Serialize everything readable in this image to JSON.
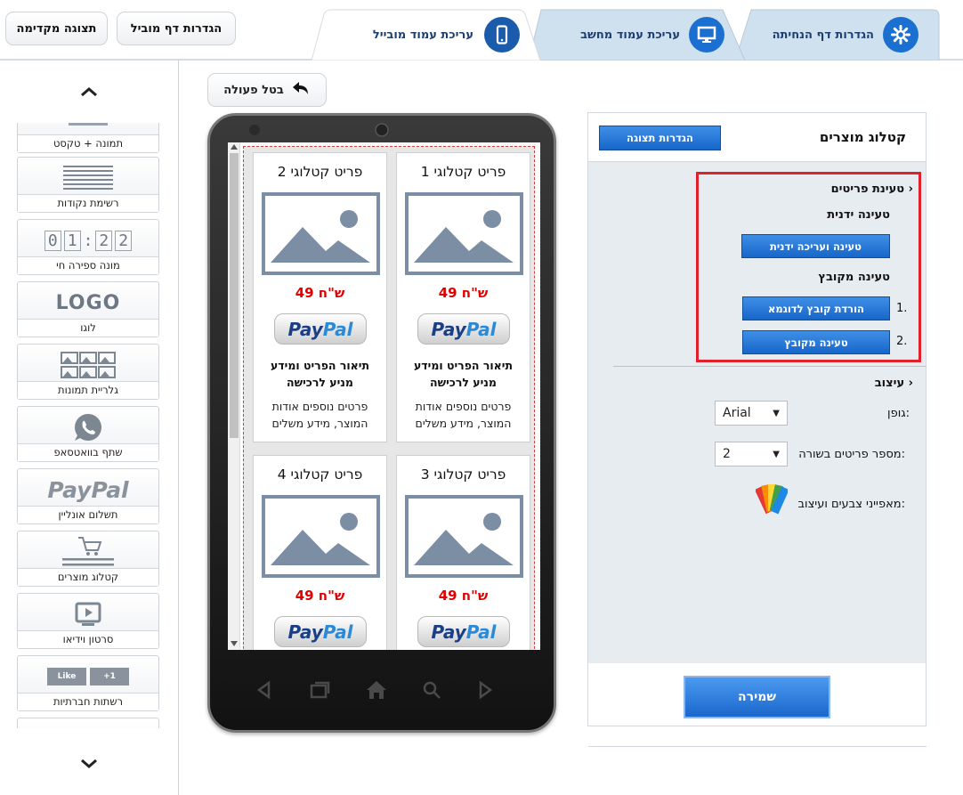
{
  "top": {
    "preview_label": "תצוגה מקדימה",
    "landing_settings_label": "הגדרות דף מוביל",
    "tabs": [
      {
        "label": "עריכת עמוד מובייל",
        "icon": "mobile-icon",
        "active": true
      },
      {
        "label": "עריכת עמוד מחשב",
        "icon": "desktop-icon",
        "active": false
      },
      {
        "label": "הגדרות דף הנחיתה",
        "icon": "gear-icon",
        "active": false
      }
    ]
  },
  "sidebar": {
    "items": [
      {
        "label": "תמונה + טקסט",
        "icon": "image-text-icon"
      },
      {
        "label": "רשימת נקודות",
        "icon": "bullet-list-icon"
      },
      {
        "label": "מונה ספירה חי",
        "icon": "countdown-icon",
        "digits": [
          "0",
          "1",
          ":",
          "2",
          "2"
        ]
      },
      {
        "label": "לוגו",
        "icon": "logo-icon",
        "logo_text": "LOGO"
      },
      {
        "label": "גלריית תמונות",
        "icon": "gallery-icon"
      },
      {
        "label": "שתף בוואטסאפ",
        "icon": "whatsapp-icon"
      },
      {
        "label": "תשלום אונליין",
        "icon": "paypal-icon",
        "logo_text": "PayPal"
      },
      {
        "label": "קטלוג מוצרים",
        "icon": "cart-icon"
      },
      {
        "label": "סרטון וידיאו",
        "icon": "video-icon"
      },
      {
        "label": "רשתות חברתיות",
        "icon": "social-icon",
        "like_text": "Like",
        "plus_text": "+1"
      }
    ]
  },
  "undo_label": "בטל פעולה",
  "phone": {
    "products": [
      {
        "title": "פריט קטלוגי 1",
        "price": "49 ש\"ח",
        "desc": "תיאור הפריט ומידע מניע לרכישה",
        "more": "פרטים נוספים אודות המוצר, מידע משלים"
      },
      {
        "title": "פריט קטלוגי 2",
        "price": "49 ש\"ח",
        "desc": "תיאור הפריט ומידע מניע לרכישה",
        "more": "פרטים נוספים אודות המוצר, מידע משלים"
      },
      {
        "title": "פריט קטלוגי 3",
        "price": "49 ש\"ח"
      },
      {
        "title": "פריט קטלוגי 4",
        "price": "49 ש\"ח"
      }
    ],
    "paypal": {
      "p1": "Pay",
      "p2": "Pal"
    }
  },
  "panel": {
    "title": "קטלוג מוצרים",
    "display_settings_label": "הגדרות תצוגה",
    "loading_section": "טעינת פריטים",
    "manual_loading": "טעינה ידנית",
    "manual_button": "טעינה ועריכה ידנית",
    "file_loading": "טעינה מקובץ",
    "step1_num": "1.",
    "step1_button": "הורדת קובץ לדוגמא",
    "step2_num": "2.",
    "step2_button": "טעינה מקובץ",
    "design_section": "עיצוב",
    "font_label": "גופן:",
    "font_value": "Arial",
    "per_row_label": "מספר פריטים בשורה:",
    "per_row_value": "2",
    "colors_label": "מאפייני צבעים ועיצוב:",
    "save_label": "שמירה"
  },
  "colors": {
    "accent": "#1a6fd0",
    "highlight": "#e2202c",
    "price": "#e00000"
  }
}
